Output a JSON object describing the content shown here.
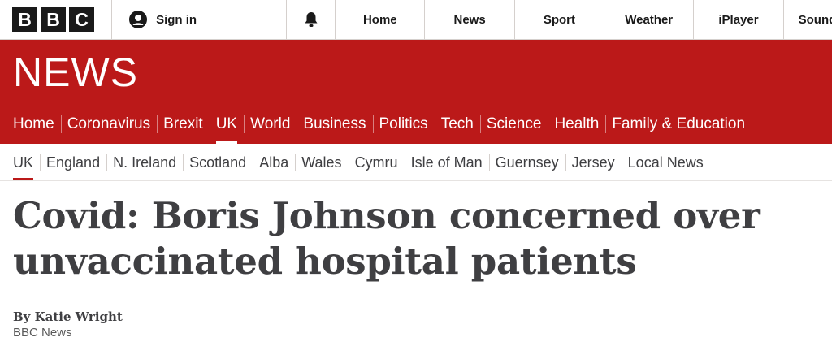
{
  "global_nav": {
    "logo_letters": [
      "B",
      "B",
      "C"
    ],
    "sign_in_label": "Sign in",
    "user_icon": "user-icon",
    "notification_icon": "bell-icon",
    "links": [
      "Home",
      "News",
      "Sport",
      "Weather",
      "iPlayer",
      "Sounds"
    ]
  },
  "banner": {
    "wordmark": "NEWS",
    "background_color": "#bb1919"
  },
  "section_nav": {
    "items": [
      "Home",
      "Coronavirus",
      "Brexit",
      "UK",
      "World",
      "Business",
      "Politics",
      "Tech",
      "Science",
      "Health",
      "Family & Education"
    ],
    "active": "UK"
  },
  "sub_nav": {
    "items": [
      "UK",
      "England",
      "N. Ireland",
      "Scotland",
      "Alba",
      "Wales",
      "Cymru",
      "Isle of Man",
      "Guernsey",
      "Jersey",
      "Local News"
    ],
    "active": "UK"
  },
  "article": {
    "headline_line1": "Covid: Boris Johnson concerned over",
    "headline_line2": "unvaccinated hospital patients",
    "byline_name": "By Katie Wright",
    "byline_org": "BBC News"
  }
}
